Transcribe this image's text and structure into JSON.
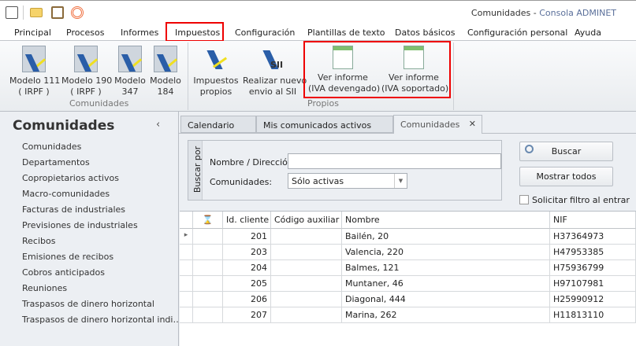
{
  "window": {
    "title": "Comunidades",
    "separator": " - ",
    "app": "Consola ADMINET"
  },
  "quick_access": [
    "home-icon",
    "mail-icon",
    "clipboard-icon",
    "broadcast-icon"
  ],
  "menu": {
    "items": [
      "Principal",
      "Procesos",
      "Informes",
      "Impuestos",
      "Configuración",
      "Plantillas de texto",
      "Datos básicos",
      "Configuración personal",
      "Ayuda"
    ],
    "active": "Impuestos"
  },
  "ribbon": {
    "groups": [
      {
        "label": "Comunidades"
      },
      {
        "label": "Propios"
      }
    ],
    "buttons": [
      {
        "line1": "Modelo 111",
        "line2": "( IRPF )"
      },
      {
        "line1": "Modelo 190",
        "line2": "( IRPF )"
      },
      {
        "line1": "Modelo",
        "line2": "347"
      },
      {
        "line1": "Modelo",
        "line2": "184"
      },
      {
        "line1": "Impuestos",
        "line2": "propios"
      },
      {
        "line1": "Realizar nuevo",
        "line2": "envio al SII",
        "badge": "SII"
      },
      {
        "line1": "Ver informe",
        "line2": "(IVA devengado)"
      },
      {
        "line1": "Ver informe",
        "line2": "(IVA soportado)"
      }
    ]
  },
  "sidebar": {
    "title": "Comunidades",
    "collapse": "‹",
    "items": [
      "Comunidades",
      "Departamentos",
      "Copropietarios activos",
      "Macro-comunidades",
      "Facturas de industriales",
      "Previsiones de industriales",
      "Recibos",
      "Emisiones de recibos",
      "Cobros anticipados",
      "Reuniones",
      "Traspasos de dinero horizontal",
      "Traspasos de dinero horizontal indi…"
    ]
  },
  "tabs": [
    {
      "label": "Calendario"
    },
    {
      "label": "Mis comunicados activos"
    },
    {
      "label": "Comunidades",
      "close": "✕"
    }
  ],
  "search": {
    "caption": "Buscar por",
    "name_label": "Nombre / Dirección:",
    "name_value": "",
    "comunidades_label": "Comunidades:",
    "comunidades_value": "Sólo activas",
    "buscar": "Buscar",
    "mostrar_todos": "Mostrar todos",
    "solicitar_filtro": "Solicitar filtro al entrar",
    "solicitar_checked": false
  },
  "grid": {
    "columns": [
      "⌛",
      "Id. cliente",
      "Código auxiliar",
      "Nombre",
      "NIF"
    ],
    "rows": [
      {
        "id": "201",
        "codigo": "",
        "nombre": "Bailén, 20",
        "nif": "H37364973"
      },
      {
        "id": "203",
        "codigo": "",
        "nombre": "Valencia, 220",
        "nif": "H47953385"
      },
      {
        "id": "204",
        "codigo": "",
        "nombre": "Balmes, 121",
        "nif": "H75936799"
      },
      {
        "id": "205",
        "codigo": "",
        "nombre": "Muntaner, 46",
        "nif": "H97107981"
      },
      {
        "id": "206",
        "codigo": "",
        "nombre": "Diagonal, 444",
        "nif": "H25990912"
      },
      {
        "id": "207",
        "codigo": "",
        "nombre": "Marina, 262",
        "nif": "H11813110"
      }
    ],
    "current_row_marker": "▸"
  }
}
